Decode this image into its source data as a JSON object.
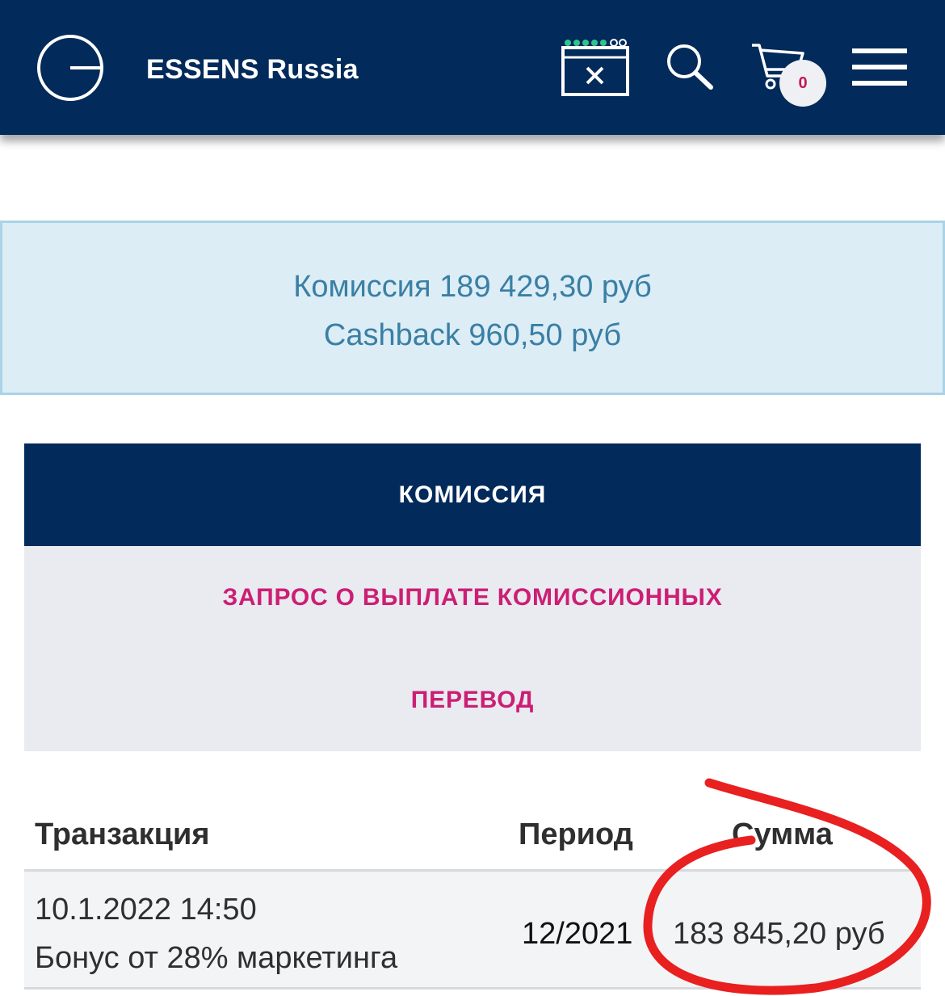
{
  "header": {
    "brand": "ESSENS Russia",
    "icons": [
      "essens-logo-icon",
      "adblock-icon",
      "search-icon",
      "cart-icon",
      "hamburger-menu-icon"
    ],
    "cart_count": "0",
    "background_color": "#022a5a"
  },
  "balance": {
    "commission": "Комиссия 189 429,30 руб",
    "cashback": "Cashback 960,50 руб"
  },
  "nav": {
    "active": "КОМИССИЯ",
    "items": [
      "ЗАПРОС О ВЫПЛАТЕ КОМИССИОННЫХ",
      "ПЕРЕВОД"
    ],
    "accent_color": "#cc1e74"
  },
  "table": {
    "headers": {
      "transaction": "Транзакция",
      "period": "Период",
      "sum": "Сумма"
    },
    "rows": [
      {
        "datetime": "10.1.2022 14:50",
        "description": "Бонус от 28% маркетинга",
        "period": "12/2021",
        "sum": "183 845,20 руб"
      }
    ]
  },
  "annotation": {
    "type": "red-hand-drawn-circle",
    "color": "#e82020"
  }
}
